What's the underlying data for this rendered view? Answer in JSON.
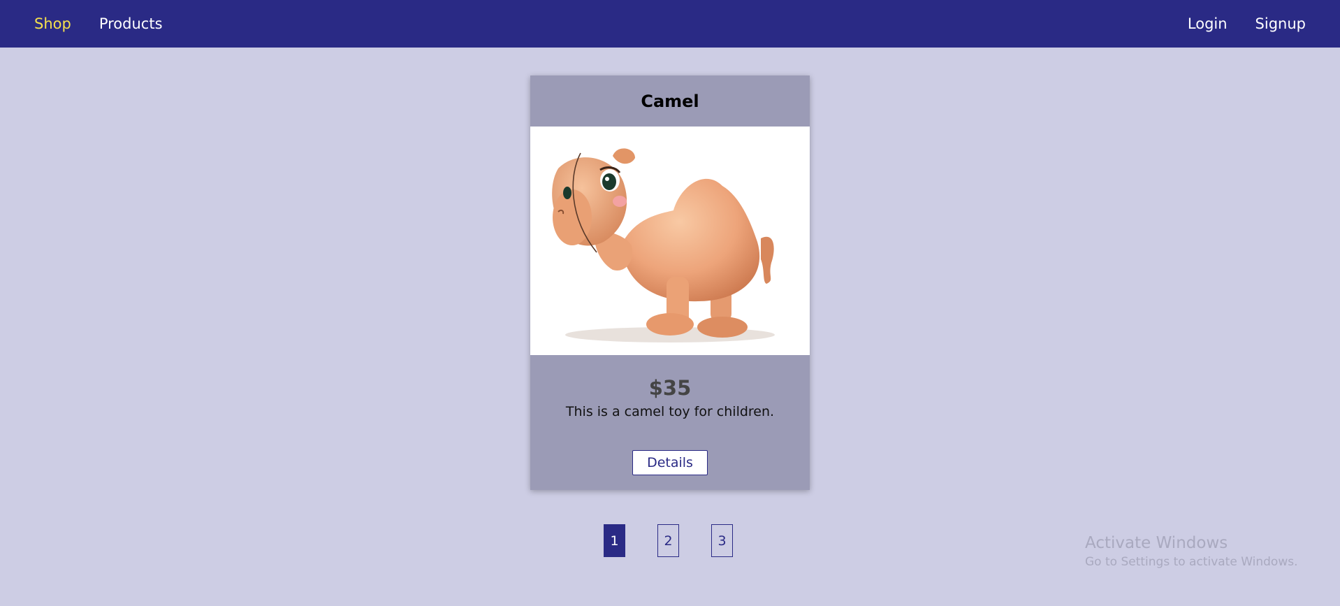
{
  "nav": {
    "left": [
      {
        "label": "Shop",
        "active": true
      },
      {
        "label": "Products",
        "active": false
      }
    ],
    "right": [
      {
        "label": "Login"
      },
      {
        "label": "Signup"
      }
    ]
  },
  "product": {
    "title": "Camel",
    "price": "$35",
    "description": "This is a camel toy for children.",
    "details_label": "Details",
    "image_icon": "camel-toy-image"
  },
  "pagination": {
    "pages": [
      "1",
      "2",
      "3"
    ],
    "current": "1"
  },
  "watermark": {
    "title": "Activate Windows",
    "subtitle": "Go to Settings to activate Windows."
  },
  "colors": {
    "navbar": "#2a2a85",
    "active_link": "#f4e04d",
    "background": "#cdcde4",
    "card": "#9b9bb6"
  }
}
